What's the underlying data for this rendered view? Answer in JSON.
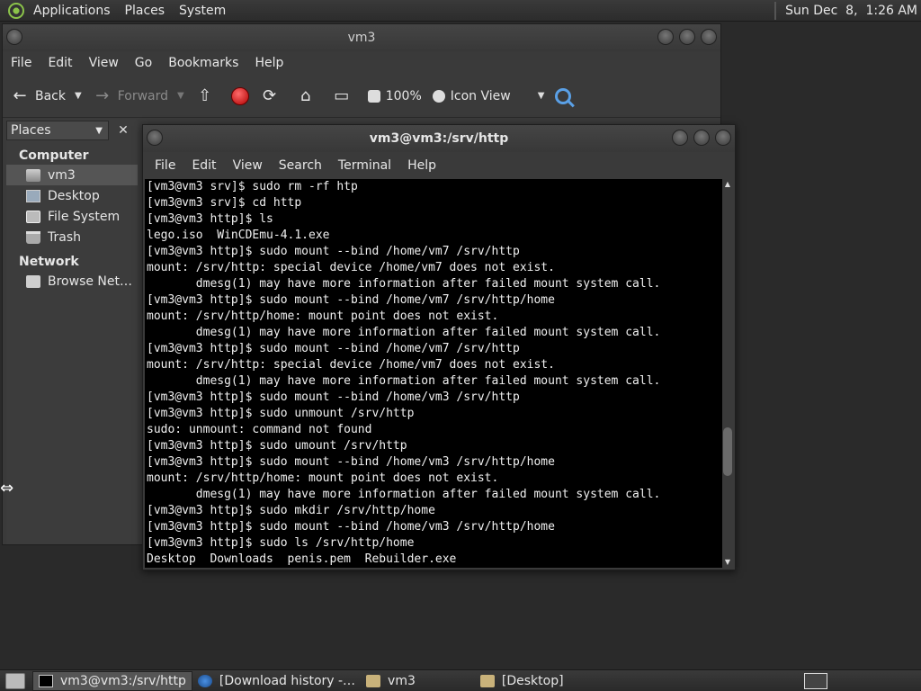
{
  "top_panel": {
    "menus": [
      "Applications",
      "Places",
      "System"
    ],
    "clock": "Sun Dec  8,  1:26 AM"
  },
  "file_manager": {
    "title": "vm3",
    "menus": [
      "File",
      "Edit",
      "View",
      "Go",
      "Bookmarks",
      "Help"
    ],
    "toolbar": {
      "back": "Back",
      "forward": "Forward",
      "zoom": "100%",
      "view_mode": "Icon View"
    },
    "sidebar": {
      "selector": "Places",
      "groups": [
        {
          "label": "Computer",
          "items": [
            "vm3",
            "Desktop",
            "File System",
            "Trash"
          ]
        },
        {
          "label": "Network",
          "items": [
            "Browse Net…"
          ]
        }
      ]
    }
  },
  "terminal": {
    "title": "vm3@vm3:/srv/http",
    "menus": [
      "File",
      "Edit",
      "View",
      "Search",
      "Terminal",
      "Help"
    ],
    "lines": [
      "[vm3@vm3 srv]$ sudo rm -rf htp",
      "[vm3@vm3 srv]$ cd http",
      "[vm3@vm3 http]$ ls",
      "lego.iso  WinCDEmu-4.1.exe",
      "[vm3@vm3 http]$ sudo mount --bind /home/vm7 /srv/http",
      "mount: /srv/http: special device /home/vm7 does not exist.",
      "       dmesg(1) may have more information after failed mount system call.",
      "[vm3@vm3 http]$ sudo mount --bind /home/vm7 /srv/http/home",
      "mount: /srv/http/home: mount point does not exist.",
      "       dmesg(1) may have more information after failed mount system call.",
      "[vm3@vm3 http]$ sudo mount --bind /home/vm7 /srv/http",
      "mount: /srv/http: special device /home/vm7 does not exist.",
      "       dmesg(1) may have more information after failed mount system call.",
      "[vm3@vm3 http]$ sudo mount --bind /home/vm3 /srv/http",
      "[vm3@vm3 http]$ sudo unmount /srv/http",
      "sudo: unmount: command not found",
      "[vm3@vm3 http]$ sudo umount /srv/http",
      "[vm3@vm3 http]$ sudo mount --bind /home/vm3 /srv/http/home",
      "mount: /srv/http/home: mount point does not exist.",
      "       dmesg(1) may have more information after failed mount system call.",
      "[vm3@vm3 http]$ sudo mkdir /srv/http/home",
      "[vm3@vm3 http]$ sudo mount --bind /home/vm3 /srv/http/home",
      "[vm3@vm3 http]$ sudo ls /srv/http/home",
      "Desktop  Downloads  penis.pem  Rebuilder.exe"
    ]
  },
  "taskbar": {
    "tasks": [
      {
        "label": "vm3@vm3:/srv/http",
        "icon": "terminal-icon",
        "active": true
      },
      {
        "label": "[Download history -…",
        "icon": "browser-icon",
        "active": false
      },
      {
        "label": "vm3",
        "icon": "folder-icon",
        "active": false
      },
      {
        "label": "[Desktop]",
        "icon": "folder-icon",
        "active": false
      }
    ]
  }
}
